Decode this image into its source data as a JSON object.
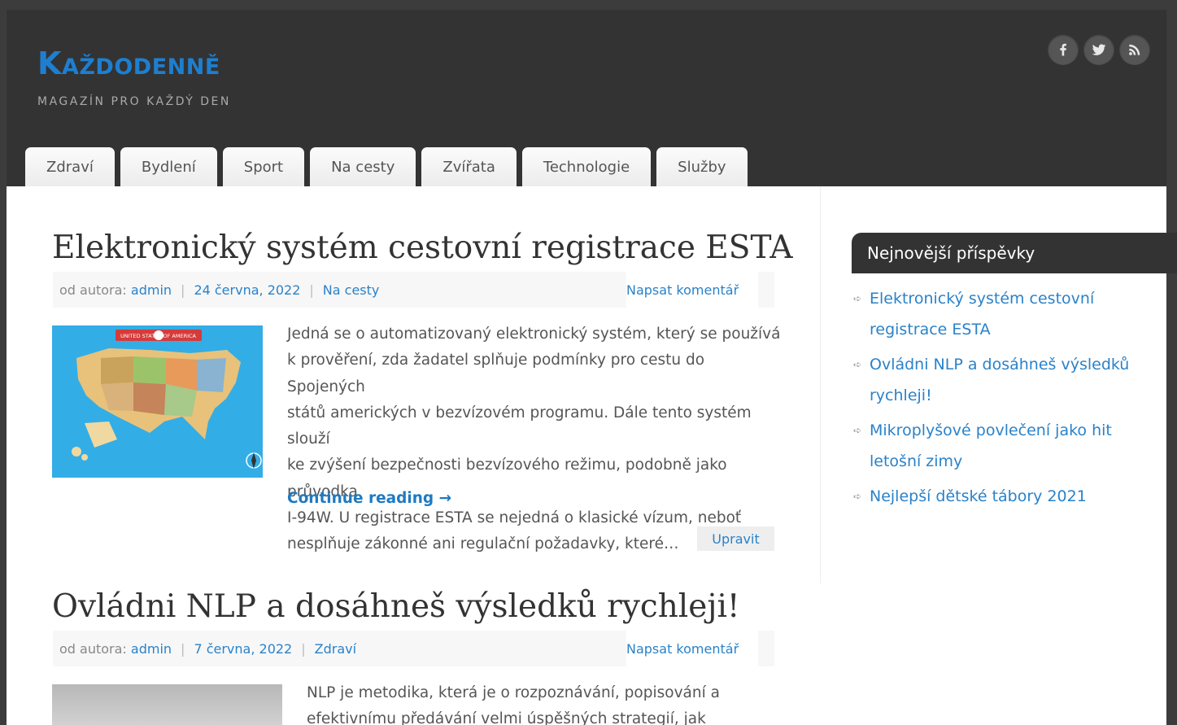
{
  "site": {
    "title": "Každodenně",
    "tagline": "MAGAZÍN PRO KAŽDÝ DEN"
  },
  "social": [
    "facebook-icon",
    "twitter-icon",
    "rss-icon"
  ],
  "nav": [
    "Zdraví",
    "Bydlení",
    "Sport",
    "Na cesty",
    "Zvířata",
    "Technologie",
    "Služby"
  ],
  "posts": [
    {
      "title": "Elektronický systém cestovní registrace ESTA",
      "meta_prefix": "od autora:",
      "author": "admin",
      "date": "24 června, 2022",
      "category": "Na cesty",
      "comment": "Napsat komentář",
      "excerpt_lines": [
        "Jedná se o automatizovaný elektronický systém, který se používá",
        "k prověření, zda žadatel splňuje podmínky pro cestu do Spojených",
        "států amerických v bezvízovém programu. Dále tento systém slouží",
        "ke zvýšení bezpečnosti bezvízového režimu, podobně jako průvodka",
        "I-94W. U registrace ESTA se nejedná o klasické vízum, neboť",
        "nesplňuje zákonné ani regulační požadavky, které…"
      ],
      "read_more": "Continue reading →",
      "edit": "Upravit",
      "image_caption": "UNITED STATES OF AMERICA"
    },
    {
      "title": "Ovládni NLP a dosáhneš výsledků rychleji!",
      "meta_prefix": "od autora:",
      "author": "admin",
      "date": "7 června, 2022",
      "category": "Zdraví",
      "comment": "Napsat komentář",
      "excerpt_lines": [
        "NLP je metodika, která je o rozpoznávání, popisování a",
        "efektivnímu předávání velmi úspěšných strategií, jak dosahovat"
      ]
    }
  ],
  "sidebar": {
    "widget_title": "Nejnovější příspěvky",
    "recent_posts": [
      [
        "Elektronický systém cestovní",
        "registrace ESTA"
      ],
      [
        "Ovládni NLP a dosáhneš výsledků",
        "rychleji!"
      ],
      [
        "Mikroplyšové povlečení jako hit",
        "letošní zimy"
      ],
      [
        "Nejlepší dětské tábory 2021"
      ]
    ]
  }
}
